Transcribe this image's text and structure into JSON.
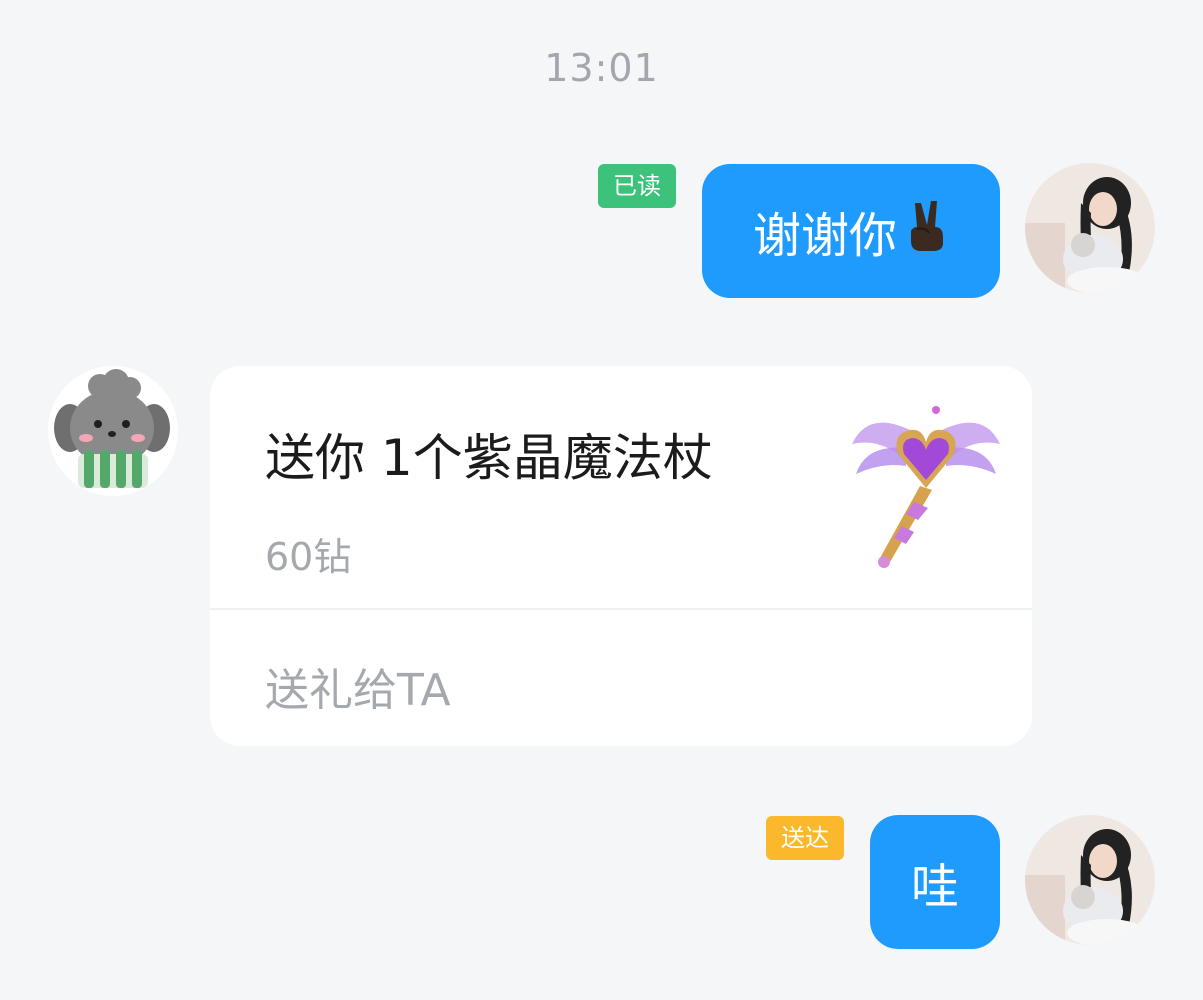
{
  "chat": {
    "timestamp": "13:01",
    "messages": [
      {
        "direction": "outgoing",
        "text": "谢谢你",
        "emoji": "✌🏿",
        "status": "已读",
        "status_color": "#3cc27a"
      },
      {
        "direction": "incoming",
        "type": "gift",
        "gift": {
          "title": "送你 1个紫晶魔法杖",
          "price": "60钻",
          "action": "送礼给TA",
          "image": "purple-crystal-magic-wand"
        }
      },
      {
        "direction": "outgoing",
        "text": "哇",
        "status": "送达",
        "status_color": "#fbb82c"
      }
    ]
  },
  "colors": {
    "background": "#f5f6f8",
    "outgoing_bubble": "#1e9bfd",
    "card": "#ffffff",
    "muted_text": "#a5a8ad"
  }
}
